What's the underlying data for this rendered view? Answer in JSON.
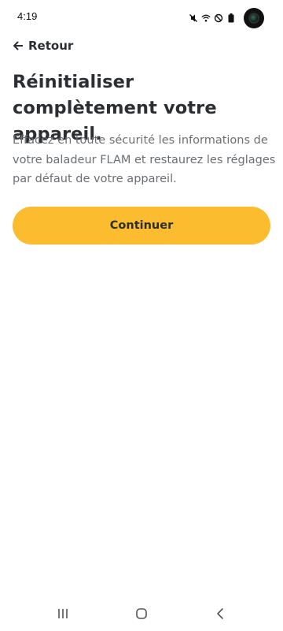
{
  "status_bar": {
    "time": "4:19",
    "icons": [
      "mute-icon",
      "wifi-icon",
      "dnd-icon",
      "battery-icon",
      "camera-icon"
    ]
  },
  "header": {
    "back_label": "Retour",
    "back_icon": "arrow-left-icon"
  },
  "main": {
    "title": "Réinitialiser complètement votre appareil.",
    "description": "Effacez en toute sécurité les informations de votre baladeur FLAM et restaurez les réglages par défaut de votre appareil.",
    "continue_label": "Continuer"
  },
  "nav_bar": {
    "icons": [
      "recents-icon",
      "home-icon",
      "back-icon"
    ]
  },
  "colors": {
    "accent": "#fbbc30",
    "text": "#2b2f33",
    "muted": "#6b6f73"
  }
}
